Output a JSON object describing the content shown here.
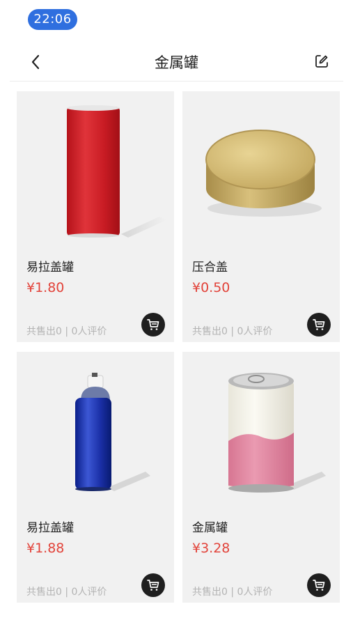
{
  "status": {
    "time": "22:06"
  },
  "nav": {
    "title": "金属罐",
    "back_icon": "chevron-left-icon",
    "edit_icon": "edit-icon"
  },
  "products": [
    {
      "name": "易拉盖罐",
      "price": "¥1.80",
      "stats": "共售出0 | 0人评价"
    },
    {
      "name": "压合盖",
      "price": "¥0.50",
      "stats": "共售出0 | 0人评价"
    },
    {
      "name": "易拉盖罐",
      "price": "¥1.88",
      "stats": "共售出0 | 0人评价"
    },
    {
      "name": "金属罐",
      "price": "¥3.28",
      "stats": "共售出0 | 0人评价"
    }
  ],
  "colors": {
    "price": "#e2433a",
    "time_pill": "#2f6fdf",
    "card_bg": "#f1f1f1"
  }
}
